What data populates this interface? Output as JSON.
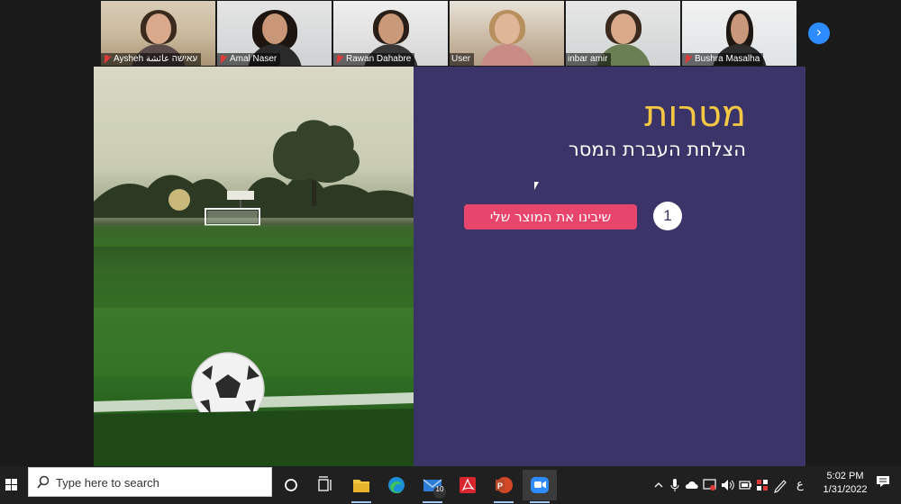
{
  "participants": [
    {
      "name": "Aysheh עאישה عائشة",
      "muted": true
    },
    {
      "name": "Amal Naser",
      "muted": true
    },
    {
      "name": "Rawan Dahabre",
      "muted": true
    },
    {
      "name": "User",
      "muted": false
    },
    {
      "name": "inbar amir",
      "muted": false,
      "active_speaker": true
    },
    {
      "name": "Bushra Masalha",
      "muted": true
    }
  ],
  "gallery": {
    "next_icon": "chevron-right-icon"
  },
  "slide": {
    "title": "מטרות",
    "subtitle": "הצלחת העברת המסר",
    "items": [
      {
        "number": "1",
        "label": "שיבינו את המוצר שלי"
      }
    ],
    "colors": {
      "panel": "#3a3469",
      "title": "#f5c842",
      "item_pill": "#e8456c"
    }
  },
  "taskbar": {
    "search_placeholder": "Type here to search",
    "apps": [
      {
        "icon": "cortana-circle-icon"
      },
      {
        "icon": "task-view-icon"
      },
      {
        "icon": "file-explorer-icon"
      },
      {
        "icon": "edge-icon"
      },
      {
        "icon": "mail-icon",
        "badge": "10"
      },
      {
        "icon": "acrobat-icon"
      },
      {
        "icon": "powerpoint-icon"
      },
      {
        "icon": "zoom-icon"
      }
    ],
    "tray": {
      "language": "ع",
      "time": "5:02 PM",
      "date": "1/31/2022"
    }
  }
}
